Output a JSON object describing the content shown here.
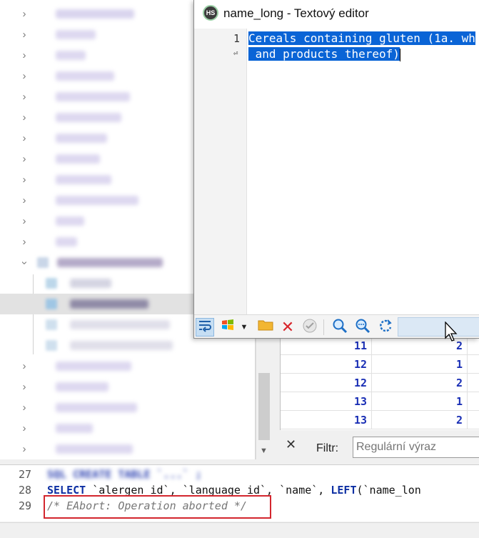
{
  "editor_window": {
    "title": "name_long - Textový editor",
    "app_icon_text": "HS",
    "line_number": "1",
    "text_line1": "Cereals containing gluten (1a. wh",
    "text_line2": " and products thereof)",
    "toolbar": {
      "word_wrap_icon": "word-wrap-icon",
      "encoding_icon": "windows-logo-icon",
      "open_icon": "folder-icon",
      "clear_icon": "delete-icon",
      "apply_icon": "check-icon",
      "find_icon": "search-icon",
      "find_next_icon": "search-next-icon",
      "replace_icon": "replace-icon"
    }
  },
  "results_grid": {
    "rows": [
      [
        "11",
        "2"
      ],
      [
        "12",
        "1"
      ],
      [
        "12",
        "2"
      ],
      [
        "13",
        "1"
      ],
      [
        "13",
        "2"
      ]
    ]
  },
  "filter": {
    "label": "Filtr:",
    "placeholder": "Regulární výraz"
  },
  "sql_editor": {
    "lines": [
      {
        "number": "27",
        "code": "SQL CREATE TABLE `...` ;"
      },
      {
        "number": "28",
        "kw1": "SELECT",
        "code_mid": " `alergen_id`, `language_id`, `name`, ",
        "kw2": "LEFT",
        "code_end": "(`name_lon"
      },
      {
        "number": "29",
        "comment": "/* EAbort: Operation aborted */"
      }
    ]
  },
  "colors": {
    "selection": "#0a64d6",
    "grid_text": "#1a2fb5",
    "highlight_box": "#d3262e"
  }
}
